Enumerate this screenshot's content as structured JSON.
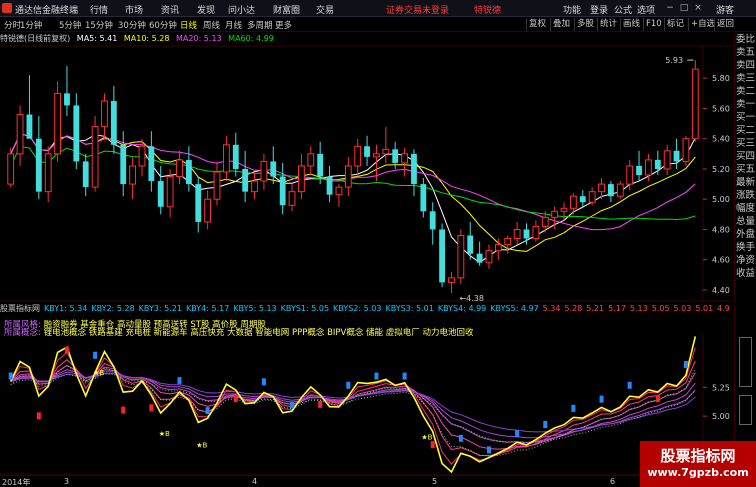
{
  "titlebar": {
    "app_name": "通达信金融终端",
    "menus": [
      "行情",
      "市场",
      "资讯",
      "发现",
      "问小达",
      "财富圈",
      "交易"
    ],
    "alert": "证券交易未登录",
    "stock_name": "特锐德",
    "right_menus": [
      "功能",
      "登录",
      "公式",
      "选项"
    ],
    "guest": "游客",
    "min": "−",
    "max": "□",
    "close": "×"
  },
  "toolbar": {
    "periods": [
      "分时",
      "1分钟",
      "5分钟",
      "15分钟",
      "30分钟",
      "60分钟",
      "日线",
      "周线",
      "月线",
      "多周期",
      "更多"
    ],
    "active_period": "日线",
    "right_tools": [
      "复权",
      "叠加",
      "多股",
      "统计",
      "画线",
      "F10",
      "标记",
      "+自选",
      "返回"
    ]
  },
  "chart_header": {
    "title": "特锐德(日线前复权)",
    "ma": [
      {
        "label": "MA5: 5.41",
        "color": "#ffffff"
      },
      {
        "label": "MA10: 5.28",
        "color": "#ffff00"
      },
      {
        "label": "MA20: 5.13",
        "color": "#ff44ff"
      },
      {
        "label": "MA60: 4.99",
        "color": "#00dd00"
      }
    ]
  },
  "right_column": [
    "委比",
    "卖五",
    "卖四",
    "卖三",
    "卖二",
    "卖一",
    "买一",
    "买二",
    "买三",
    "买四",
    "买五",
    "最新",
    "涨跌",
    "幅度",
    "总量",
    "外盘",
    "换手",
    "净资",
    "收益"
  ],
  "price_axis": [
    "5.80",
    "5.60",
    "5.40",
    "5.20",
    "5.00",
    "4.80",
    "4.60",
    "4.40"
  ],
  "price_annotations": {
    "high": "5.93",
    "low": "4.38"
  },
  "indicator_header": {
    "title": "股票指标网",
    "items": [
      {
        "label": "KBY1: 5.34",
        "color": "#00ccff"
      },
      {
        "label": "KBY2: 5.28",
        "color": "#00ccff"
      },
      {
        "label": "KBY3: 5.21",
        "color": "#00ccff"
      },
      {
        "label": "KBY4: 5.17",
        "color": "#00ccff"
      },
      {
        "label": "KBY5: 5.13",
        "color": "#00ccff"
      },
      {
        "label": "KBYS1: 5.05",
        "color": "#00ccff"
      },
      {
        "label": "KBYS2: 5.03",
        "color": "#00ccff"
      },
      {
        "label": "KBYS3: 5.01",
        "color": "#00ccff"
      },
      {
        "label": "KBYS4: 4.99",
        "color": "#00ccff"
      },
      {
        "label": "KBYS5: 4.97",
        "color": "#00ccff"
      },
      {
        "label": "5.34",
        "color": "#ff4444"
      },
      {
        "label": "5.28",
        "color": "#ff4444"
      },
      {
        "label": "5.21",
        "color": "#ff4444"
      },
      {
        "label": "5.17",
        "color": "#ff4444"
      },
      {
        "label": "5.13",
        "color": "#ff4444"
      },
      {
        "label": "5.05",
        "color": "#ff4444"
      },
      {
        "label": "5.03",
        "color": "#ff4444"
      },
      {
        "label": "5.01",
        "color": "#ff4444"
      },
      {
        "label": "4.9",
        "color": "#ff4444"
      }
    ]
  },
  "concepts": {
    "label1": "所属风格:",
    "text1": "融资融券 基金重仓 高动量股 预高送转 ST股 高价股 周期股",
    "label2": "所属概念:",
    "text2": "锂电池概念 铁路基建 充电桩 新能源车 高压快充 大数据 智能电网 PPP概念 BIPV概念 储能 虚拟电厂 动力电池回收"
  },
  "indicator_axis": [
    "5.25",
    "5.00",
    "4.75"
  ],
  "date_axis": [
    {
      "label": "2014年",
      "kind": "year"
    },
    {
      "label": "3",
      "kind": "month"
    },
    {
      "label": "4",
      "kind": "month"
    },
    {
      "label": "5",
      "kind": "month"
    },
    {
      "label": "6",
      "kind": "month"
    }
  ],
  "watermark": {
    "line1": "股票指标网",
    "line2": "www.7gpzb.com"
  },
  "colors": {
    "up": "#ff3030",
    "down": "#44dddd",
    "ma5": "#ffffff",
    "ma10": "#ffff00",
    "ma20": "#ff44ff",
    "ma60": "#00dd00",
    "grid": "#3a0000"
  },
  "chart_data": {
    "type": "candlestick",
    "title": "特锐德(日线前复权)",
    "ylim": [
      4.36,
      6.0
    ],
    "candles": [
      [
        5.1,
        5.34,
        5.08,
        5.3
      ],
      [
        5.3,
        5.62,
        5.22,
        5.56
      ],
      [
        5.56,
        5.82,
        5.5,
        5.4
      ],
      [
        5.4,
        5.55,
        5.0,
        5.05
      ],
      [
        5.05,
        5.35,
        4.98,
        5.3
      ],
      [
        5.3,
        5.78,
        5.25,
        5.7
      ],
      [
        5.7,
        5.88,
        5.55,
        5.62
      ],
      [
        5.62,
        5.7,
        5.2,
        5.25
      ],
      [
        5.25,
        5.3,
        5.02,
        5.08
      ],
      [
        5.08,
        5.55,
        5.05,
        5.48
      ],
      [
        5.48,
        5.7,
        5.4,
        5.65
      ],
      [
        5.65,
        5.75,
        5.3,
        5.36
      ],
      [
        5.36,
        5.45,
        5.02,
        5.1
      ],
      [
        5.1,
        5.28,
        5.0,
        5.22
      ],
      [
        5.22,
        5.4,
        5.15,
        5.35
      ],
      [
        5.35,
        5.45,
        5.05,
        5.12
      ],
      [
        5.12,
        5.22,
        4.9,
        4.95
      ],
      [
        4.95,
        5.2,
        4.88,
        5.15
      ],
      [
        5.15,
        5.32,
        5.1,
        5.26
      ],
      [
        5.26,
        5.35,
        5.05,
        5.1
      ],
      [
        5.1,
        5.15,
        4.78,
        4.85
      ],
      [
        4.85,
        5.06,
        4.8,
        5.0
      ],
      [
        5.0,
        5.25,
        4.96,
        5.18
      ],
      [
        5.18,
        5.42,
        5.12,
        5.36
      ],
      [
        5.36,
        5.44,
        5.15,
        5.2
      ],
      [
        5.2,
        5.32,
        4.98,
        5.05
      ],
      [
        5.05,
        5.18,
        5.0,
        5.12
      ],
      [
        5.12,
        5.3,
        5.06,
        5.25
      ],
      [
        5.25,
        5.35,
        5.1,
        5.15
      ],
      [
        5.15,
        5.24,
        4.9,
        4.96
      ],
      [
        4.96,
        5.1,
        4.92,
        5.05
      ],
      [
        5.05,
        5.3,
        5.0,
        5.22
      ],
      [
        5.22,
        5.35,
        5.16,
        5.3
      ],
      [
        5.3,
        5.38,
        5.1,
        5.15
      ],
      [
        5.15,
        5.22,
        4.98,
        5.03
      ],
      [
        5.03,
        5.1,
        4.95,
        5.08
      ],
      [
        5.08,
        5.28,
        5.02,
        5.22
      ],
      [
        5.22,
        5.4,
        5.15,
        5.35
      ],
      [
        5.35,
        5.42,
        5.22,
        5.28
      ],
      [
        5.28,
        5.36,
        5.12,
        5.3
      ],
      [
        5.3,
        5.48,
        5.24,
        5.33
      ],
      [
        5.33,
        5.38,
        5.2,
        5.24
      ],
      [
        5.24,
        5.34,
        5.15,
        5.3
      ],
      [
        5.3,
        5.33,
        5.02,
        5.1
      ],
      [
        5.1,
        5.14,
        4.88,
        4.92
      ],
      [
        4.92,
        4.98,
        4.7,
        4.8
      ],
      [
        4.8,
        4.84,
        4.42,
        4.45
      ],
      [
        4.45,
        4.52,
        4.38,
        4.48
      ],
      [
        4.48,
        4.8,
        4.44,
        4.76
      ],
      [
        4.76,
        4.85,
        4.6,
        4.64
      ],
      [
        4.64,
        4.72,
        4.56,
        4.58
      ],
      [
        4.58,
        4.7,
        4.54,
        4.66
      ],
      [
        4.66,
        4.74,
        4.6,
        4.7
      ],
      [
        4.7,
        4.76,
        4.64,
        4.74
      ],
      [
        4.74,
        4.85,
        4.7,
        4.8
      ],
      [
        4.8,
        4.84,
        4.7,
        4.74
      ],
      [
        4.74,
        4.86,
        4.72,
        4.82
      ],
      [
        4.82,
        4.92,
        4.78,
        4.88
      ],
      [
        4.88,
        4.95,
        4.8,
        4.92
      ],
      [
        4.92,
        4.98,
        4.86,
        4.94
      ],
      [
        4.94,
        5.04,
        4.9,
        5.02
      ],
      [
        5.02,
        5.06,
        4.94,
        4.98
      ],
      [
        4.98,
        5.08,
        4.96,
        5.05
      ],
      [
        5.05,
        5.14,
        5.0,
        5.1
      ],
      [
        5.1,
        5.12,
        4.98,
        5.02
      ],
      [
        5.02,
        5.12,
        5.0,
        5.1
      ],
      [
        5.1,
        5.26,
        5.06,
        5.22
      ],
      [
        5.22,
        5.32,
        5.12,
        5.16
      ],
      [
        5.16,
        5.3,
        5.12,
        5.26
      ],
      [
        5.26,
        5.32,
        5.16,
        5.2
      ],
      [
        5.2,
        5.36,
        5.16,
        5.32
      ],
      [
        5.32,
        5.4,
        5.2,
        5.25
      ],
      [
        5.25,
        5.42,
        5.22,
        5.4
      ],
      [
        5.4,
        5.92,
        5.38,
        5.86
      ]
    ]
  }
}
